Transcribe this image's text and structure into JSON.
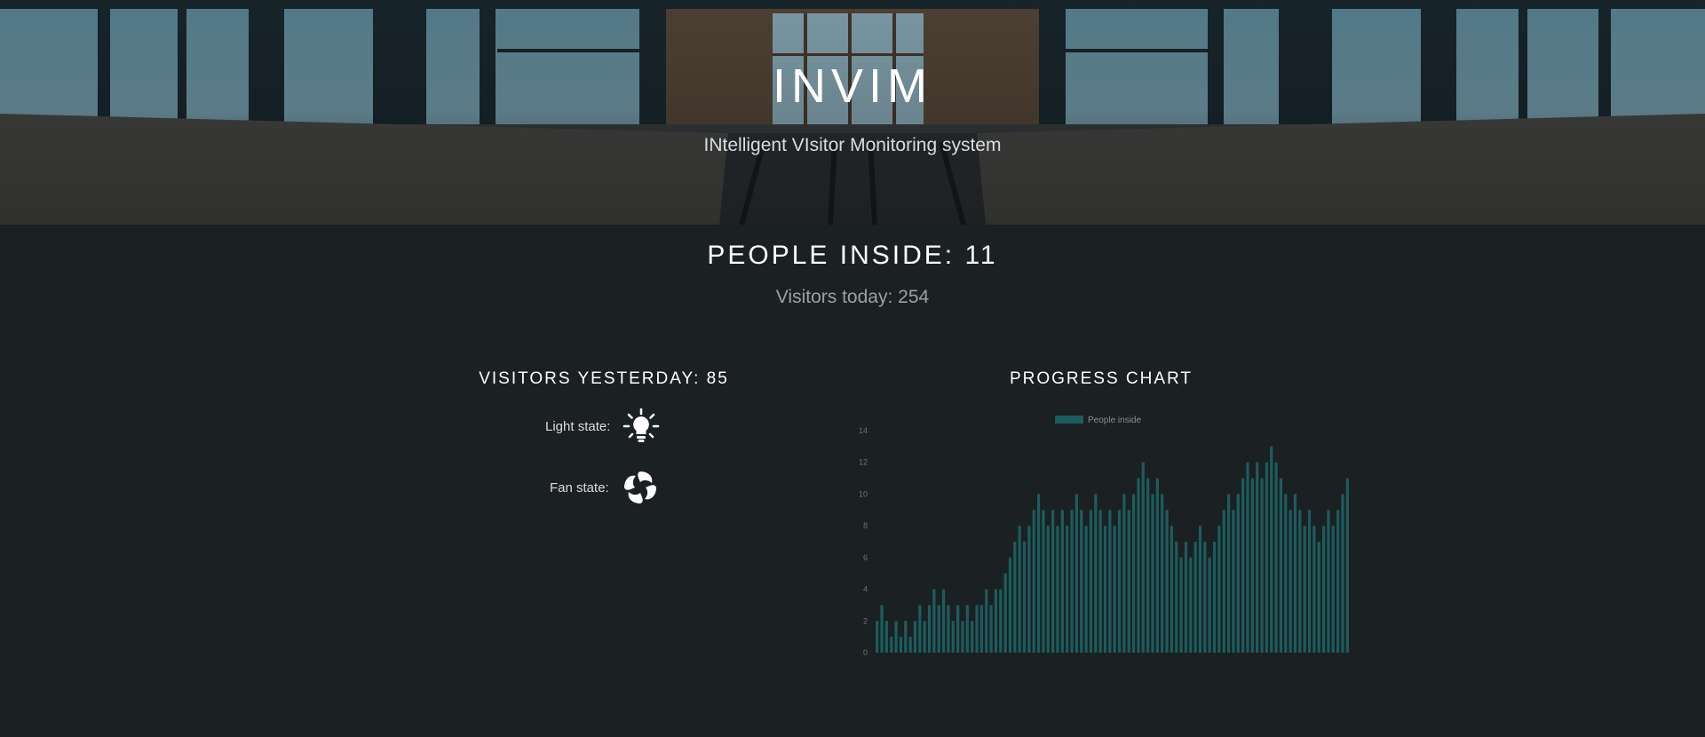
{
  "header": {
    "title": "INVIM",
    "subtitle": "INtelligent VIsitor Monitoring system"
  },
  "stats": {
    "people_inside": "PEOPLE INSIDE: 11",
    "visitors_today": "Visitors today: 254",
    "visitors_yesterday": "VISITORS YESTERDAY: 85"
  },
  "states": {
    "light_label": "Light state:",
    "light_icon": "lightbulb-icon",
    "fan_label": "Fan state:",
    "fan_icon": "fan-icon"
  },
  "colors": {
    "background": "#1b2023",
    "bar": "#1d5c5d",
    "text": "#ffffff",
    "muted": "#9aa0a4"
  },
  "chart_data": {
    "title": "PROGRESS CHART",
    "type": "bar",
    "legend": "top-center",
    "ylim": [
      0,
      14
    ],
    "yticks": [
      "0",
      "2",
      "4",
      "6",
      "8",
      "10",
      "12",
      "14"
    ],
    "series": [
      {
        "name": "People inside",
        "values": [
          2,
          3,
          2,
          1,
          2,
          1,
          2,
          1,
          2,
          3,
          2,
          3,
          4,
          3,
          4,
          3,
          2,
          3,
          2,
          3,
          2,
          3,
          3,
          4,
          3,
          4,
          4,
          5,
          6,
          7,
          8,
          7,
          8,
          9,
          10,
          9,
          8,
          9,
          8,
          9,
          8,
          9,
          10,
          9,
          8,
          9,
          10,
          9,
          8,
          9,
          8,
          9,
          10,
          9,
          10,
          11,
          12,
          11,
          10,
          11,
          10,
          9,
          8,
          7,
          6,
          7,
          6,
          7,
          8,
          7,
          6,
          7,
          8,
          9,
          10,
          9,
          10,
          11,
          12,
          11,
          12,
          11,
          12,
          13,
          12,
          11,
          10,
          9,
          10,
          9,
          8,
          9,
          8,
          7,
          8,
          9,
          8,
          9,
          10,
          11
        ]
      }
    ]
  }
}
